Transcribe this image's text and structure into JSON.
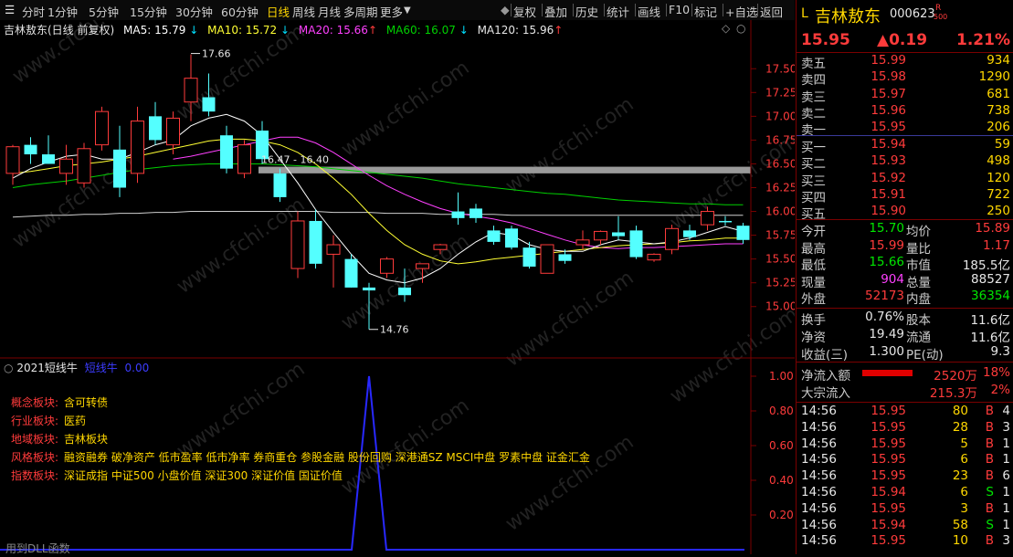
{
  "toolbar": {
    "periods": [
      "分时",
      "1分钟",
      "5分钟",
      "15分钟",
      "30分钟",
      "60分钟",
      "日线",
      "周线",
      "月线",
      "多周期",
      "更多"
    ],
    "active_period": "日线",
    "right_buttons": [
      "复权",
      "叠加",
      "历史",
      "统计",
      "画线",
      "F10",
      "标记",
      "+自选",
      "返回"
    ]
  },
  "chart_header": {
    "title": "吉林敖东(日线 前复权)",
    "ma5": "MA5: 15.79",
    "ma10": "MA10: 15.72",
    "ma20": "MA20: 15.66",
    "ma60": "MA60: 16.07",
    "ma120": "MA120: 15.96",
    "high_label": "17.66",
    "low_label": "14.76",
    "range_label": "16.47 - 16.40"
  },
  "price_axis": [
    "17.50",
    "17.25",
    "17.00",
    "16.75",
    "16.50",
    "16.25",
    "16.00",
    "15.75",
    "15.50",
    "15.25",
    "15.00"
  ],
  "indicator": {
    "name": "2021短线牛",
    "sub": "短线牛",
    "value": "0.00",
    "axis": [
      "1.00",
      "0.80",
      "0.60",
      "0.40",
      "0.20"
    ],
    "footer": "用到DLL函数"
  },
  "annotations": [
    {
      "label": "概念板块:",
      "value": "含可转债"
    },
    {
      "label": "行业板块:",
      "value": "医药"
    },
    {
      "label": "地域板块:",
      "value": "吉林板块"
    },
    {
      "label": "风格板块:",
      "value": "融资融券 破净资产 低市盈率 低市净率 券商重仓 参股金融 股份回购 深港通SZ MSCI中盘 罗素中盘 证金汇金"
    },
    {
      "label": "指数板块:",
      "value": "深证成指 中证500 小盘价值 深证300 深证价值 国证价值"
    }
  ],
  "watermark": "www.cfchi.com",
  "stock": {
    "flag": "L",
    "name": "吉林敖东",
    "code": "000623",
    "badge_top": "R",
    "badge_bottom": "500",
    "price": "15.95",
    "change": "▲0.19",
    "pct": "1.21%"
  },
  "sell_orders": [
    {
      "label": "卖五",
      "price": "15.99",
      "vol": "934"
    },
    {
      "label": "卖四",
      "price": "15.98",
      "vol": "1290"
    },
    {
      "label": "卖三",
      "price": "15.97",
      "vol": "681"
    },
    {
      "label": "卖二",
      "price": "15.96",
      "vol": "738"
    },
    {
      "label": "卖一",
      "price": "15.95",
      "vol": "206"
    }
  ],
  "buy_orders": [
    {
      "label": "买一",
      "price": "15.94",
      "vol": "59"
    },
    {
      "label": "买二",
      "price": "15.93",
      "vol": "498"
    },
    {
      "label": "买三",
      "price": "15.92",
      "vol": "120"
    },
    {
      "label": "买四",
      "price": "15.91",
      "vol": "722"
    },
    {
      "label": "买五",
      "price": "15.90",
      "vol": "250"
    }
  ],
  "stats": [
    {
      "l1": "今开",
      "v1": "15.70",
      "c1": "green",
      "l2": "均价",
      "v2": "15.89",
      "c2": "red"
    },
    {
      "l1": "最高",
      "v1": "15.99",
      "c1": "red",
      "l2": "量比",
      "v2": "1.17",
      "c2": "red"
    },
    {
      "l1": "最低",
      "v1": "15.66",
      "c1": "green",
      "l2": "市值",
      "v2": "185.5亿",
      "c2": "white"
    },
    {
      "l1": "现量",
      "v1": "904",
      "c1": "mag",
      "l2": "总量",
      "v2": "88527",
      "c2": "white"
    },
    {
      "l1": "外盘",
      "v1": "52173",
      "c1": "red",
      "l2": "内盘",
      "v2": "36354",
      "c2": "green"
    }
  ],
  "fundamentals": [
    {
      "l1": "换手",
      "v1": "0.76%",
      "l2": "股本",
      "v2": "11.6亿"
    },
    {
      "l1": "净资",
      "v1": "19.49",
      "l2": "流通",
      "v2": "11.6亿"
    },
    {
      "l1": "收益(三)",
      "v1": "1.300",
      "l2": "PE(动)",
      "v2": "9.3"
    }
  ],
  "flows": [
    {
      "label": "净流入额",
      "value": "2520万",
      "pct": "18%"
    },
    {
      "label": "大宗流入",
      "value": "215.3万",
      "pct": "2%"
    }
  ],
  "ticks": [
    {
      "time": "14:56",
      "price": "15.95",
      "vol": "80",
      "side": "B",
      "n": "4"
    },
    {
      "time": "14:56",
      "price": "15.95",
      "vol": "28",
      "side": "B",
      "n": "3"
    },
    {
      "time": "14:56",
      "price": "15.95",
      "vol": "5",
      "side": "B",
      "n": "1"
    },
    {
      "time": "14:56",
      "price": "15.95",
      "vol": "6",
      "side": "B",
      "n": "1"
    },
    {
      "time": "14:56",
      "price": "15.95",
      "vol": "23",
      "side": "B",
      "n": "6"
    },
    {
      "time": "14:56",
      "price": "15.94",
      "vol": "6",
      "side": "S",
      "n": "1"
    },
    {
      "time": "14:56",
      "price": "15.95",
      "vol": "3",
      "side": "B",
      "n": "1"
    },
    {
      "time": "14:56",
      "price": "15.94",
      "vol": "58",
      "side": "S",
      "n": "1"
    },
    {
      "time": "14:56",
      "price": "15.95",
      "vol": "10",
      "side": "B",
      "n": "3"
    }
  ],
  "colors": {
    "up": "#ff3b3b",
    "down": "#54ffff",
    "ma5": "#ffffff",
    "ma10": "#ffff33",
    "ma20": "#ff40ff",
    "ma60": "#00d000",
    "ma120": "#cfcfcf",
    "indicator": "#2828ff"
  },
  "chart_data": {
    "type": "candlestick",
    "ylim": [
      14.7,
      17.7
    ],
    "candles": [
      {
        "o": 16.4,
        "h": 16.7,
        "l": 16.28,
        "c": 16.68
      },
      {
        "o": 16.7,
        "h": 16.78,
        "l": 16.5,
        "c": 16.6
      },
      {
        "o": 16.6,
        "h": 16.8,
        "l": 16.5,
        "c": 16.5
      },
      {
        "o": 16.4,
        "h": 16.7,
        "l": 16.28,
        "c": 16.55
      },
      {
        "o": 16.3,
        "h": 16.72,
        "l": 16.25,
        "c": 16.66
      },
      {
        "o": 16.7,
        "h": 17.1,
        "l": 16.64,
        "c": 17.05
      },
      {
        "o": 16.65,
        "h": 16.9,
        "l": 16.15,
        "c": 16.25
      },
      {
        "o": 16.4,
        "h": 17.1,
        "l": 16.3,
        "c": 16.95
      },
      {
        "o": 17.0,
        "h": 17.15,
        "l": 16.7,
        "c": 16.75
      },
      {
        "o": 16.7,
        "h": 17.05,
        "l": 16.6,
        "c": 16.98
      },
      {
        "o": 17.15,
        "h": 17.65,
        "l": 16.95,
        "c": 17.4
      },
      {
        "o": 17.2,
        "h": 17.45,
        "l": 17.0,
        "c": 17.05
      },
      {
        "o": 16.8,
        "h": 16.9,
        "l": 16.4,
        "c": 16.45
      },
      {
        "o": 16.4,
        "h": 16.75,
        "l": 16.35,
        "c": 16.7
      },
      {
        "o": 16.85,
        "h": 16.95,
        "l": 16.5,
        "c": 16.55
      },
      {
        "o": 16.4,
        "h": 16.45,
        "l": 16.1,
        "c": 16.15
      },
      {
        "o": 15.4,
        "h": 16.0,
        "l": 15.3,
        "c": 15.9
      },
      {
        "o": 15.9,
        "h": 16.02,
        "l": 15.4,
        "c": 15.45
      },
      {
        "o": 15.55,
        "h": 15.75,
        "l": 15.2,
        "c": 15.65
      },
      {
        "o": 15.5,
        "h": 15.55,
        "l": 15.2,
        "c": 15.2
      },
      {
        "o": 15.2,
        "h": 15.25,
        "l": 14.76,
        "c": 15.17
      },
      {
        "o": 15.35,
        "h": 15.52,
        "l": 15.3,
        "c": 15.5
      },
      {
        "o": 15.2,
        "h": 15.4,
        "l": 15.05,
        "c": 15.12
      },
      {
        "o": 15.4,
        "h": 15.45,
        "l": 15.25,
        "c": 15.45
      },
      {
        "o": 15.6,
        "h": 15.66,
        "l": 15.55,
        "c": 15.65
      },
      {
        "o": 16.0,
        "h": 16.2,
        "l": 15.86,
        "c": 15.93
      },
      {
        "o": 16.03,
        "h": 16.08,
        "l": 15.88,
        "c": 15.93
      },
      {
        "o": 15.8,
        "h": 15.85,
        "l": 15.65,
        "c": 15.68
      },
      {
        "o": 15.82,
        "h": 15.85,
        "l": 15.6,
        "c": 15.62
      },
      {
        "o": 15.62,
        "h": 15.68,
        "l": 15.4,
        "c": 15.42
      },
      {
        "o": 15.35,
        "h": 15.65,
        "l": 15.35,
        "c": 15.65
      },
      {
        "o": 15.55,
        "h": 15.6,
        "l": 15.45,
        "c": 15.48
      },
      {
        "o": 15.65,
        "h": 15.8,
        "l": 15.6,
        "c": 15.7
      },
      {
        "o": 15.7,
        "h": 15.8,
        "l": 15.65,
        "c": 15.79
      },
      {
        "o": 15.78,
        "h": 15.95,
        "l": 15.7,
        "c": 15.74
      },
      {
        "o": 15.8,
        "h": 15.85,
        "l": 15.5,
        "c": 15.52
      },
      {
        "o": 15.49,
        "h": 15.56,
        "l": 15.47,
        "c": 15.55
      },
      {
        "o": 15.6,
        "h": 15.86,
        "l": 15.55,
        "c": 15.82
      },
      {
        "o": 15.8,
        "h": 15.86,
        "l": 15.7,
        "c": 15.73
      },
      {
        "o": 15.86,
        "h": 16.05,
        "l": 15.8,
        "c": 16.0
      },
      {
        "o": 15.9,
        "h": 15.95,
        "l": 15.85,
        "c": 15.89
      },
      {
        "o": 15.85,
        "h": 15.88,
        "l": 15.66,
        "c": 15.7
      }
    ],
    "ma5": [
      16.35,
      16.45,
      16.52,
      16.58,
      16.6,
      16.55,
      16.55,
      16.62,
      16.7,
      16.75,
      16.9,
      16.98,
      17.02,
      16.95,
      16.8,
      16.55,
      16.3,
      16.02,
      15.78,
      15.55,
      15.35,
      15.28,
      15.25,
      15.3,
      15.4,
      15.55,
      15.68,
      15.78,
      15.75,
      15.65,
      15.6,
      15.58,
      15.58,
      15.65,
      15.7,
      15.68,
      15.66,
      15.68,
      15.72,
      15.78,
      15.84,
      15.79
    ],
    "ma10": [
      16.4,
      16.42,
      16.45,
      16.48,
      16.5,
      16.52,
      16.55,
      16.58,
      16.62,
      16.66,
      16.7,
      16.74,
      16.76,
      16.76,
      16.74,
      16.7,
      16.62,
      16.5,
      16.35,
      16.18,
      15.98,
      15.8,
      15.65,
      15.55,
      15.48,
      15.45,
      15.47,
      15.5,
      15.52,
      15.54,
      15.56,
      15.58,
      15.6,
      15.62,
      15.64,
      15.65,
      15.66,
      15.67,
      15.69,
      15.7,
      15.72,
      15.72
    ],
    "ma20": [
      null,
      null,
      null,
      null,
      null,
      null,
      null,
      null,
      null,
      16.55,
      16.58,
      16.62,
      16.66,
      16.7,
      16.74,
      16.78,
      16.78,
      16.72,
      16.62,
      16.5,
      16.38,
      16.27,
      16.18,
      16.1,
      16.03,
      15.98,
      15.95,
      15.92,
      15.88,
      15.82,
      15.76,
      15.7,
      15.65,
      15.62,
      15.61,
      15.62,
      15.62,
      15.63,
      15.64,
      15.65,
      15.66,
      15.66
    ],
    "ma60": [
      16.25,
      16.28,
      16.3,
      16.32,
      16.35,
      16.38,
      16.41,
      16.44,
      16.46,
      16.48,
      16.49,
      16.5,
      16.5,
      16.5,
      16.5,
      16.49,
      16.48,
      16.47,
      16.45,
      16.43,
      16.41,
      16.39,
      16.37,
      16.35,
      16.32,
      16.29,
      16.27,
      16.25,
      16.23,
      16.21,
      16.19,
      16.18,
      16.16,
      16.14,
      16.12,
      16.11,
      16.1,
      16.09,
      16.08,
      16.08,
      16.07,
      16.07
    ],
    "ma120": [
      15.94,
      15.95,
      15.96,
      15.96,
      15.97,
      15.97,
      15.98,
      15.98,
      15.99,
      15.99,
      16.0,
      16.0,
      16.0,
      16.0,
      16.0,
      16.0,
      16.0,
      16.0,
      15.99,
      15.99,
      15.99,
      15.98,
      15.98,
      15.98,
      15.97,
      15.97,
      15.97,
      15.97,
      15.96,
      15.96,
      15.96,
      15.96,
      15.96,
      15.96,
      15.96,
      15.96,
      15.96,
      15.96,
      15.96,
      15.96,
      15.96,
      15.96
    ],
    "resistance_band": [
      16.4,
      16.47
    ],
    "signal": {
      "index": 20,
      "value": 1.0
    }
  }
}
